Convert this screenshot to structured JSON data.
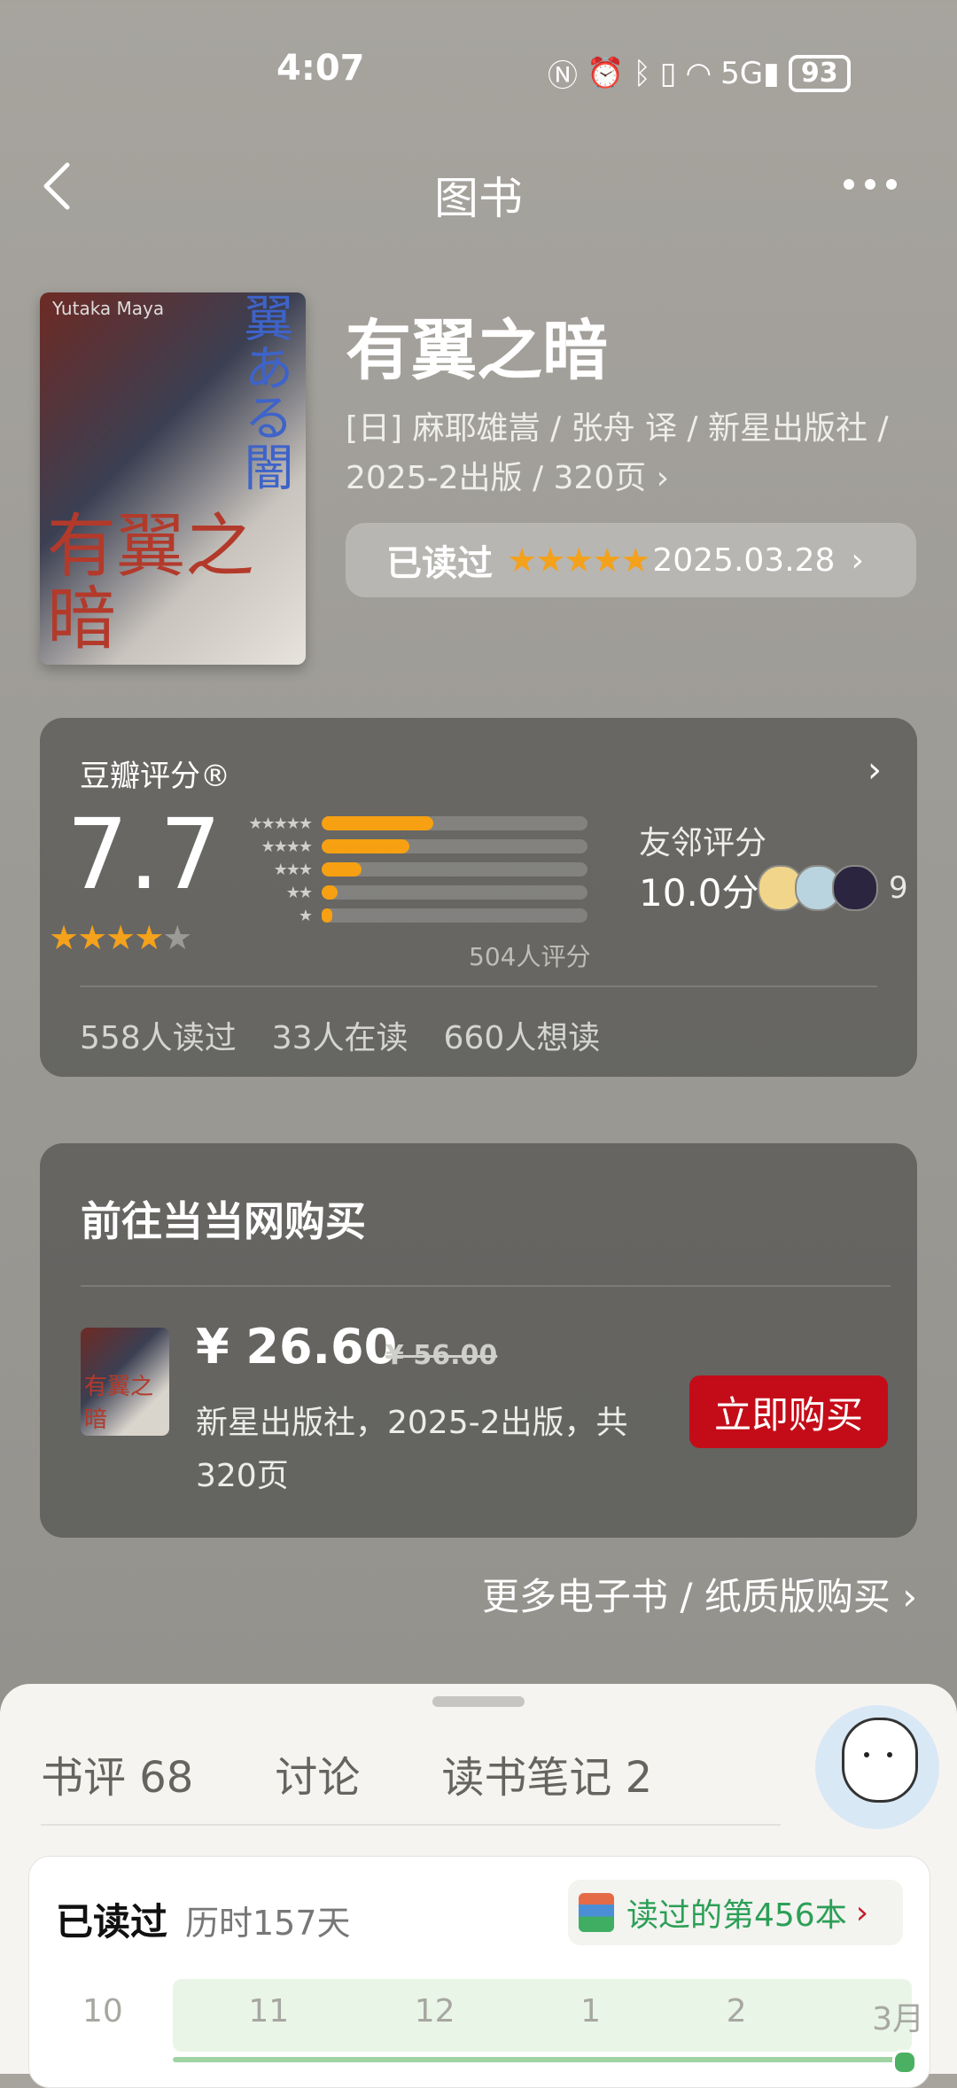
{
  "status": {
    "time": "4:07",
    "battery": "93",
    "icons": [
      "nfc-icon",
      "alarm-icon",
      "bluetooth-icon",
      "vibrate-icon",
      "wifi-icon",
      "5g-signal-icon"
    ]
  },
  "nav": {
    "title": "图书"
  },
  "book": {
    "title": "有翼之暗",
    "meta_line1": "[日] 麻耶雄嵩 / 张舟 译 / 新星出版社 /",
    "meta_line2": "2025-2出版 / 320页 ›",
    "cover_text": "有翼之暗",
    "cover_text_jp": "翼ある闇",
    "cover_author": "Yutaka Maya",
    "read_label": "已读过",
    "read_stars": "★★★★★",
    "read_date": "2025.03.28"
  },
  "rating": {
    "label": "豆瓣评分®",
    "score": "7.7",
    "stars_on": "★★★★",
    "stars_off": "★",
    "distribution": [
      {
        "stars": "★★★★★",
        "fraction": 0.42
      },
      {
        "stars": "★★★★",
        "fraction": 0.33
      },
      {
        "stars": "★★★",
        "fraction": 0.15
      },
      {
        "stars": "★★",
        "fraction": 0.06
      },
      {
        "stars": "★",
        "fraction": 0.04
      }
    ],
    "count": "504人评分",
    "friends_label": "友邻评分",
    "friends_score": "10.0分",
    "friends_count": "9",
    "read": "558人读过",
    "reading": "33人在读",
    "want": "660人想读"
  },
  "buy": {
    "heading": "前往当当网购买",
    "price": "¥ 26.60",
    "original_price": "¥ 56.00",
    "description": "新星出版社，2025-2出版，共320页",
    "button": "立即购买",
    "thumb_text": "有翼之暗",
    "more_link": "更多电子书 / 纸质版购买 ›"
  },
  "tabs": [
    {
      "label": "书评 68"
    },
    {
      "label": "讨论"
    },
    {
      "label": "读书笔记 2"
    }
  ],
  "reading_record": {
    "label": "已读过",
    "duration": "历时157天",
    "badge": "读过的第456本",
    "months": [
      "10",
      "11",
      "12",
      "1",
      "2",
      "3月"
    ]
  }
}
